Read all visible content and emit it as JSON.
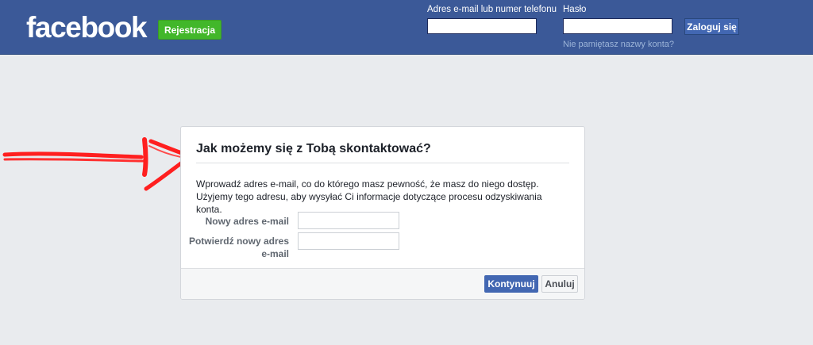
{
  "header": {
    "logo_text": "facebook",
    "signup_label": "Rejestracja",
    "email_label": "Adres e-mail lub numer telefonu",
    "email_value": "",
    "password_label": "Hasło",
    "password_value": "",
    "login_label": "Zaloguj się",
    "forgot_link": "Nie pamiętasz nazwy konta?"
  },
  "dialog": {
    "title": "Jak możemy się z Tobą skontaktować?",
    "description": "Wprowadź adres e-mail, co do którego masz pewność, że masz do niego dostęp. Użyjemy tego adresu, aby wysyłać Ci informacje dotyczące procesu odzyskiwania konta.",
    "new_email_label": "Nowy adres e-mail",
    "new_email_value": "",
    "confirm_email_label": "Potwierdź nowy adres e-mail",
    "confirm_email_value": "",
    "continue_label": "Kontynuuj",
    "cancel_label": "Anuluj"
  },
  "annotation": {
    "arrow_color": "#ff1f1f",
    "arrow_icon": "red-arrow-annotation"
  },
  "colors": {
    "brand_blue": "#3b5998",
    "signup_green": "#42b72a",
    "page_background": "#e9ebee"
  }
}
